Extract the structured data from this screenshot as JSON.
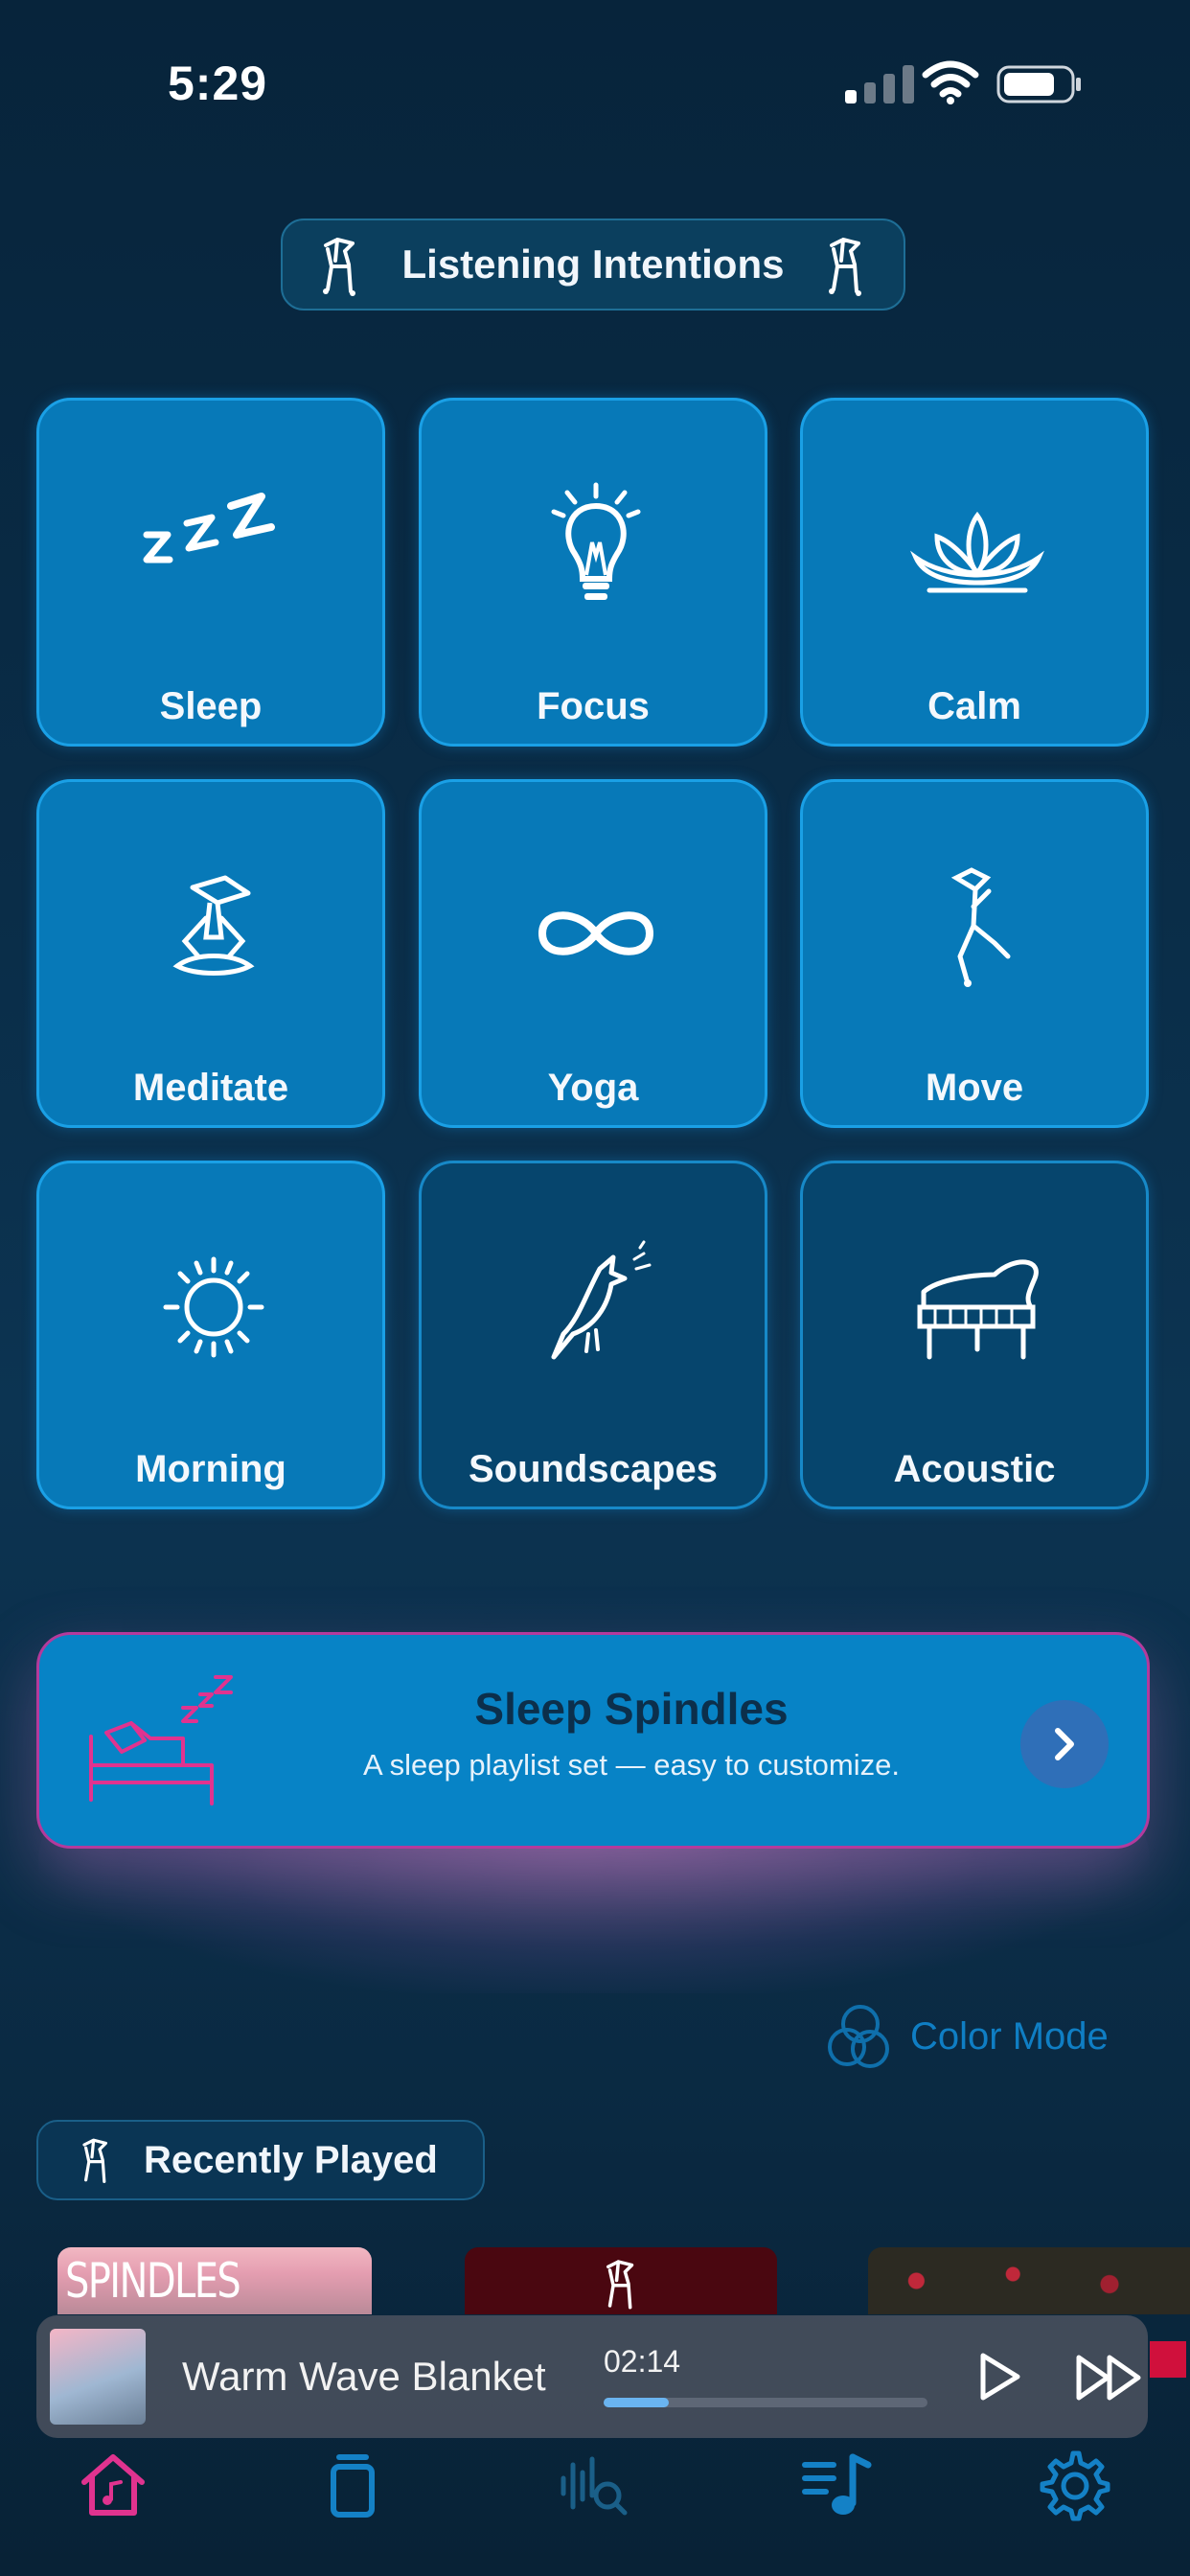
{
  "status_bar": {
    "time": "5:29"
  },
  "header": {
    "title": "Listening Intentions"
  },
  "intentions": [
    {
      "label": "Sleep",
      "icon": "zzz-icon"
    },
    {
      "label": "Focus",
      "icon": "lightbulb-icon"
    },
    {
      "label": "Calm",
      "icon": "lotus-icon"
    },
    {
      "label": "Meditate",
      "icon": "meditating-figure-icon"
    },
    {
      "label": "Yoga",
      "icon": "infinity-icon"
    },
    {
      "label": "Move",
      "icon": "dancing-figure-icon"
    },
    {
      "label": "Morning",
      "icon": "sun-icon"
    },
    {
      "label": "Soundscapes",
      "icon": "bird-icon"
    },
    {
      "label": "Acoustic",
      "icon": "piano-icon"
    }
  ],
  "banner": {
    "title": "Sleep Spindles",
    "subtitle": "A sleep playlist set — easy to customize.",
    "icon": "sleeping-bed-icon"
  },
  "color_mode": {
    "label": "Color Mode"
  },
  "recently_played": {
    "title": "Recently Played",
    "thumbnail_text": "SPINDLES"
  },
  "now_playing": {
    "title": "Warm Wave Blanket",
    "elapsed": "02:14",
    "progress": 0.2
  },
  "tabs": [
    "home-icon",
    "library-icon",
    "sound-search-icon",
    "playlist-icon",
    "settings-icon"
  ],
  "colors": {
    "tile_blue": "#0779b8",
    "tile_dark": "#06456d",
    "accent_pink": "#e0338f",
    "accent_blue": "#1481c6"
  }
}
